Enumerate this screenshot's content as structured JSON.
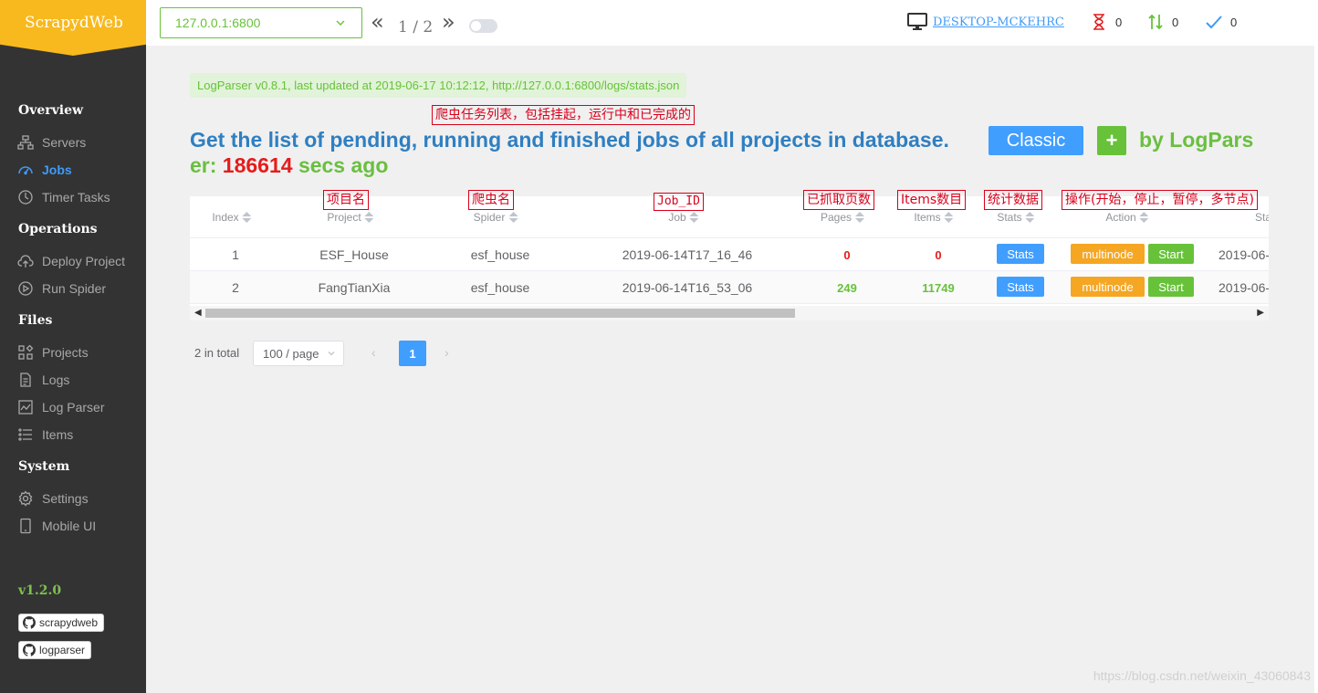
{
  "app": {
    "name": "ScrapydWeb",
    "version": "v1.2.0"
  },
  "sidebar": {
    "sections": [
      {
        "heading": "Overview",
        "items": [
          {
            "label": "Servers",
            "icon": "servers-icon"
          },
          {
            "label": "Jobs",
            "icon": "jobs-icon",
            "active": true
          },
          {
            "label": "Timer Tasks",
            "icon": "timer-icon"
          }
        ]
      },
      {
        "heading": "Operations",
        "items": [
          {
            "label": "Deploy Project",
            "icon": "deploy-icon"
          },
          {
            "label": "Run Spider",
            "icon": "run-icon"
          }
        ]
      },
      {
        "heading": "Files",
        "items": [
          {
            "label": "Projects",
            "icon": "projects-icon"
          },
          {
            "label": "Logs",
            "icon": "logs-icon"
          },
          {
            "label": "Log Parser",
            "icon": "log-parser-icon"
          },
          {
            "label": "Items",
            "icon": "items-icon"
          }
        ]
      },
      {
        "heading": "System",
        "items": [
          {
            "label": "Settings",
            "icon": "settings-icon"
          },
          {
            "label": "Mobile UI",
            "icon": "mobile-icon"
          }
        ]
      }
    ],
    "badges": [
      "scrapydweb",
      "logparser"
    ]
  },
  "header": {
    "node": "127.0.0.1:6800",
    "node_page": "1 / 2",
    "prev": "«",
    "next": "»",
    "host": "DESKTOP-MCKEHRC",
    "pending": "0",
    "running": "0",
    "finished": "0"
  },
  "banner": "LogParser v0.8.1, last updated at 2019-06-17 10:12:12, http://127.0.0.1:6800/logs/stats.json",
  "annotations": {
    "title_note": "爬虫任务列表，包括挂起，运行中和已完成的",
    "project": "项目名",
    "spider": "爬虫名",
    "job": "Job_ID",
    "pages": "已抓取页数",
    "items": "Items数目",
    "stats": "统计数据",
    "action": "操作(开始，停止，暂停，多节点)"
  },
  "title": {
    "main": "Get the list of pending, running and finished jobs of all projects in database.",
    "classic_btn": "Classic",
    "plus_btn": "+",
    "by_1": "by LogPars",
    "by_2": "er:",
    "secs": "186614",
    "ago": "secs ago"
  },
  "table": {
    "headers": {
      "index": "Index",
      "project": "Project",
      "spider": "Spider",
      "job": "Job",
      "pages": "Pages",
      "items": "Items",
      "stats": "Stats",
      "action": "Action",
      "start": "Sta"
    },
    "rows": [
      {
        "index": "1",
        "project": "ESF_House",
        "spider": "esf_house",
        "job": "2019-06-14T17_16_46",
        "pages": "0",
        "items": "0",
        "stats": "Stats",
        "multinode": "multinode",
        "start": "Start",
        "start_time": "2019-06-"
      },
      {
        "index": "2",
        "project": "FangTianXia",
        "spider": "esf_house",
        "job": "2019-06-14T16_53_06",
        "pages": "249",
        "items": "11749",
        "stats": "Stats",
        "multinode": "multinode",
        "start": "Start",
        "start_time": "2019-06-"
      }
    ]
  },
  "pagination": {
    "total": "2 in total",
    "page_size": "100 / page",
    "current": "1"
  },
  "watermark": "https://blog.csdn.net/weixin_43060843"
}
